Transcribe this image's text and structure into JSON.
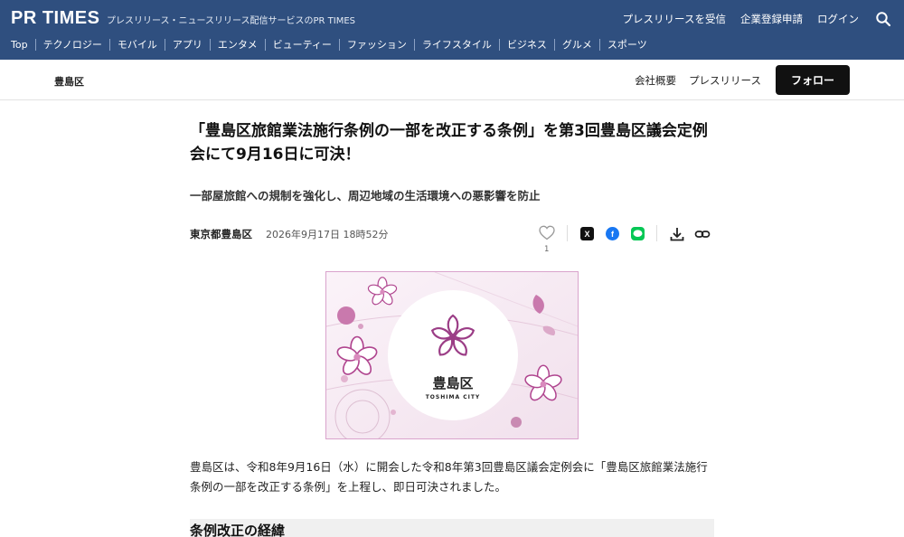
{
  "header": {
    "logo": "PR TIMES",
    "tagline": "プレスリリース・ニュースリリース配信サービスのPR TIMES",
    "actions": [
      "プレスリリースを受信",
      "企業登録申請",
      "ログイン"
    ],
    "search_icon": "search-icon",
    "categories": [
      "Top",
      "テクノロジー",
      "モバイル",
      "アプリ",
      "エンタメ",
      "ビューティー",
      "ファッション",
      "ライフスタイル",
      "ビジネス",
      "グルメ",
      "スポーツ"
    ]
  },
  "company": {
    "name": "豊島区",
    "links": [
      "会社概要",
      "プレスリリース"
    ],
    "follow_label": "フォロー"
  },
  "article": {
    "title": "「豊島区旅館業法施行条例の一部を改正する条例」を第3回豊島区議会定例会にて9月16日に可決！",
    "subtitle": "一部屋旅館への規制を強化し、周辺地域の生活環境への悪影響を防止",
    "author": "東京都豊島区",
    "date": "2026年9月17日 18時52分",
    "like_count": "1",
    "body": "豊島区は、令和8年9月16日（水）に開会した令和8年第3回豊島区議会定例会に「豊島区旅館業法施行条例の一部を改正する条例」を上程し、即日可決されました。",
    "section_heading": "条例改正の経緯"
  },
  "hero": {
    "logo_text": "豊島区",
    "logo_subtext": "TOSHIMA CITY"
  },
  "colors": {
    "header_bg": "#2f4f7f",
    "accent_pink": "#b0458f",
    "hero_bg": "#f7eef5"
  }
}
